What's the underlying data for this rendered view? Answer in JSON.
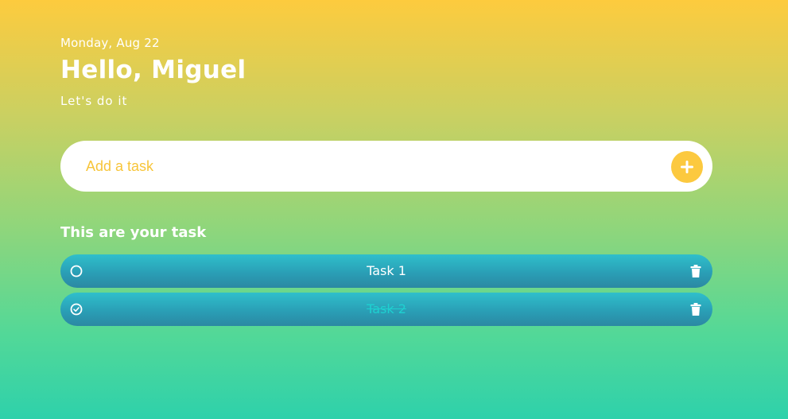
{
  "header": {
    "date": "Monday, Aug 22",
    "greeting": "Hello, Miguel",
    "subtitle": "Let's do it"
  },
  "add_task": {
    "placeholder": "Add a task",
    "button_icon": "plus-icon"
  },
  "tasks_section": {
    "title": "This are your task"
  },
  "tasks": [
    {
      "label": "Task 1",
      "completed": false,
      "check_icon": "circle-icon",
      "delete_icon": "trash-icon"
    },
    {
      "label": "Task 2",
      "completed": true,
      "check_icon": "check-circle-icon",
      "delete_icon": "trash-icon"
    }
  ],
  "colors": {
    "gradient_top": "#fdcb3e",
    "gradient_bottom": "#2ed1ab",
    "accent": "#fcc93f",
    "task_bg": "#2a9fb6",
    "completed_text": "#1ed0d0"
  }
}
